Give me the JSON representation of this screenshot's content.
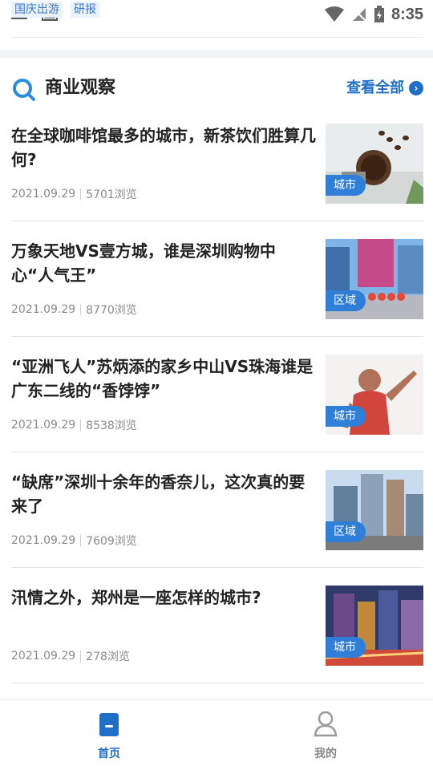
{
  "status_bar": {
    "tags": [
      "国庆出游",
      "研报"
    ],
    "time": "8:35"
  },
  "section": {
    "title": "商业观察",
    "view_all_label": "查看全部"
  },
  "articles": [
    {
      "title": "在全球咖啡馆最多的城市，新茶饮们胜算几何?",
      "date": "2021.09.29",
      "views": "5701浏览",
      "badge": "城市",
      "image": "coffee-beans"
    },
    {
      "title": "万象天地VS壹方城，谁是深圳购物中心“人气王”",
      "date": "2021.09.29",
      "views": "8770浏览",
      "badge": "区域",
      "image": "shopping-plaza"
    },
    {
      "title": "“亚洲飞人”苏炳添的家乡中山VS珠海谁是广东二线的“香饽饽”",
      "date": "2021.09.29",
      "views": "8538浏览",
      "badge": "城市",
      "image": "sprinter"
    },
    {
      "title": "“缺席”深圳十余年的香奈儿，这次真的要来了",
      "date": "2021.09.29",
      "views": "7609浏览",
      "badge": "区域",
      "image": "city-towers"
    },
    {
      "title": "汛情之外，郑州是一座怎样的城市?",
      "date": "2021.09.29",
      "views": "278浏览",
      "badge": "城市",
      "image": "zhengzhou-night"
    }
  ],
  "bottom_nav": {
    "home_label": "首页",
    "mine_label": "我的"
  },
  "colors": {
    "accent": "#1f6fc9",
    "badge": "#2f7fd8"
  }
}
